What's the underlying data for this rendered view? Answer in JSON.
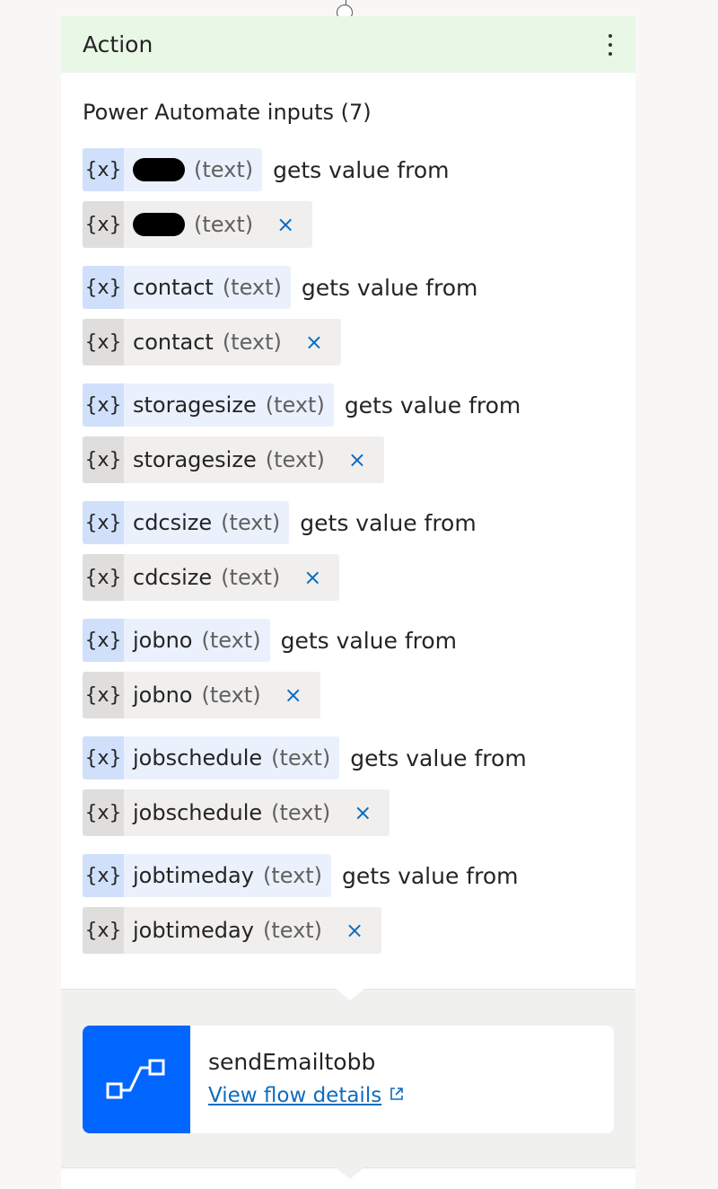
{
  "card": {
    "title": "Action",
    "more_icon": "more-vertical-icon"
  },
  "inputs": {
    "title": "Power Automate inputs (7)",
    "gets_label": "gets value from",
    "var_icon": "{x}",
    "close_icon": "×",
    "items": [
      {
        "name": "",
        "redacted": true,
        "type": "(text)"
      },
      {
        "name": "contact",
        "type": "(text)"
      },
      {
        "name": "storagesize",
        "type": "(text)"
      },
      {
        "name": "cdcsize",
        "type": "(text)"
      },
      {
        "name": "jobno",
        "type": "(text)"
      },
      {
        "name": "jobschedule",
        "type": "(text)"
      },
      {
        "name": "jobtimeday",
        "type": "(text)"
      }
    ]
  },
  "flow": {
    "name": "sendEmailtobb",
    "link": "View flow details",
    "icon": "flow-icon",
    "icon_color": "#0066ff"
  },
  "colors": {
    "header_bg": "#e9f7e6",
    "chip_blue": "#eaf1fd",
    "chip_gray": "#f0efee",
    "link": "#0f6cbd"
  }
}
